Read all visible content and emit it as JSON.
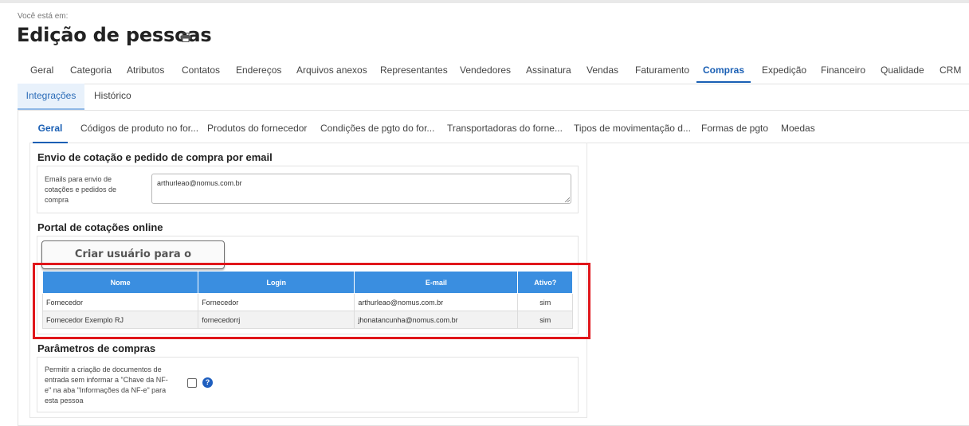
{
  "header": {
    "breadcrumb_label": "Você está em:",
    "title": "Edição de pessoas"
  },
  "main_tabs": [
    {
      "label": "Geral"
    },
    {
      "label": "Categoria"
    },
    {
      "label": "Atributos"
    },
    {
      "label": "Contatos"
    },
    {
      "label": "Endereços"
    },
    {
      "label": "Arquivos anexos"
    },
    {
      "label": "Representantes"
    },
    {
      "label": "Vendedores"
    },
    {
      "label": "Assinatura"
    },
    {
      "label": "Vendas"
    },
    {
      "label": "Faturamento"
    },
    {
      "label": "Compras",
      "active": true
    },
    {
      "label": "Expedição"
    },
    {
      "label": "Financeiro"
    },
    {
      "label": "Qualidade"
    },
    {
      "label": "CRM"
    }
  ],
  "sub_tabs": [
    {
      "label": "Integrações",
      "active": true
    },
    {
      "label": "Histórico"
    }
  ],
  "inner_tabs": [
    {
      "label": "Geral",
      "active": true
    },
    {
      "label": "Códigos de produto no for..."
    },
    {
      "label": "Produtos do fornecedor"
    },
    {
      "label": "Condições de pgto do for..."
    },
    {
      "label": "Transportadoras do forne..."
    },
    {
      "label": "Tipos de movimentação d..."
    },
    {
      "label": "Formas de pgto"
    },
    {
      "label": "Moedas"
    }
  ],
  "email_section": {
    "title": "Envio de cotação e pedido de compra por email",
    "label_lines": [
      "Emails para envio de",
      "cotações e pedidos de",
      "compra"
    ],
    "value": "arthurleao@nomus.com.br"
  },
  "portal_section": {
    "title": "Portal de cotações online",
    "create_button": "Criar usuário para o fornecedor",
    "columns": [
      "Nome",
      "Login",
      "E-mail",
      "Ativo?"
    ],
    "rows": [
      {
        "nome": "Fornecedor",
        "login": "Fornecedor",
        "email": "arthurleao@nomus.com.br",
        "ativo": "sim"
      },
      {
        "nome": "Fornecedor Exemplo RJ",
        "login": "fornecedorrj",
        "email": "jhonatancunha@nomus.com.br",
        "ativo": "sim"
      }
    ]
  },
  "params_section": {
    "title": "Parâmetros de compras",
    "label_lines": [
      "Permitir a criação de documentos de",
      "entrada sem informar a \"Chave da NF-",
      "e\" na aba \"Informações da NF-e\" para",
      "esta pessoa"
    ],
    "checked": false,
    "help": "?"
  },
  "colors": {
    "accent": "#1a5fb4",
    "table_header": "#3a8ee0",
    "highlight": "#e0161b"
  }
}
